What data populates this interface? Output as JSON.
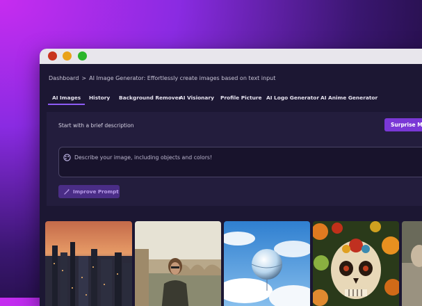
{
  "breadcrumb": {
    "root": "Dashboard",
    "separator": ">",
    "current": "AI Image Generator:  Effortlessly create images based on text input"
  },
  "tabs": [
    {
      "label": "AI Images",
      "active": true
    },
    {
      "label": "History"
    },
    {
      "label": "Background Remover"
    },
    {
      "label": "AI Visionary"
    },
    {
      "label": "Profile Picture"
    },
    {
      "label": "AI Logo Generator"
    },
    {
      "label": "AI Anime Generator"
    }
  ],
  "panel": {
    "title": "Start with a brief description",
    "surprise_label": "Surprise Me",
    "prompt_placeholder": "Describe your image, including objects and colors!",
    "improve_label": "Improve Prompt"
  },
  "gallery": [
    {
      "subject": "city skyline at sunset",
      "icon": "image"
    },
    {
      "subject": "man on bridge by river",
      "icon": "image"
    },
    {
      "subject": "floating glass sphere in clouds",
      "icon": "image"
    },
    {
      "subject": "decorated sugar skull with flowers and fruit",
      "icon": "image"
    },
    {
      "subject": "partial image",
      "icon": "image"
    }
  ],
  "colors": {
    "accent": "#7a38d6",
    "active_tab_underline": "#8d5cf6",
    "window_close": "#c8341e",
    "window_minimize": "#e9a21a",
    "window_maximize": "#2ab52a"
  }
}
